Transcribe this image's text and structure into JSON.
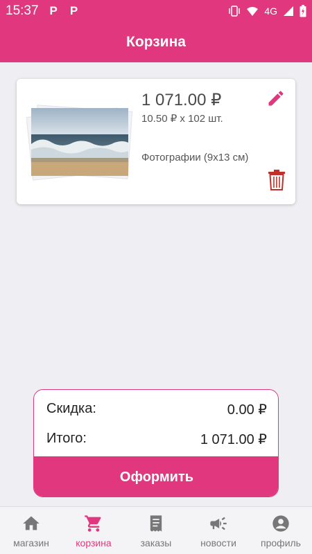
{
  "status_bar": {
    "time": "15:37",
    "app_icon_1": "Р",
    "app_icon_2": "Р",
    "network": "4G",
    "icons": [
      "vibrate-icon",
      "wifi-icon",
      "signal-icon",
      "battery-charging-icon"
    ]
  },
  "app_bar": {
    "title": "Корзина"
  },
  "cart_item": {
    "price": "1 071.00 ₽",
    "quantity_line": "10.50 ₽ x 102 шт.",
    "product_type": "Фотографии (9x13 см)",
    "icons": [
      "edit-pencil-icon",
      "trash-icon"
    ]
  },
  "summary": {
    "discount_label": "Скидка:",
    "discount_value": "0.00 ₽",
    "total_label": "Итого:",
    "total_value": "1 071.00 ₽",
    "checkout_label": "Оформить"
  },
  "bottom_nav": {
    "items": [
      {
        "label": "магазин",
        "icon": "home-icon",
        "active": false
      },
      {
        "label": "корзина",
        "icon": "cart-icon",
        "active": true
      },
      {
        "label": "заказы",
        "icon": "receipt-icon",
        "active": false
      },
      {
        "label": "новости",
        "icon": "megaphone-icon",
        "active": false
      },
      {
        "label": "профиль",
        "icon": "profile-icon",
        "active": false
      }
    ]
  },
  "colors": {
    "accent": "#e0377e",
    "background": "#efeef3",
    "delete": "#c0312b"
  }
}
